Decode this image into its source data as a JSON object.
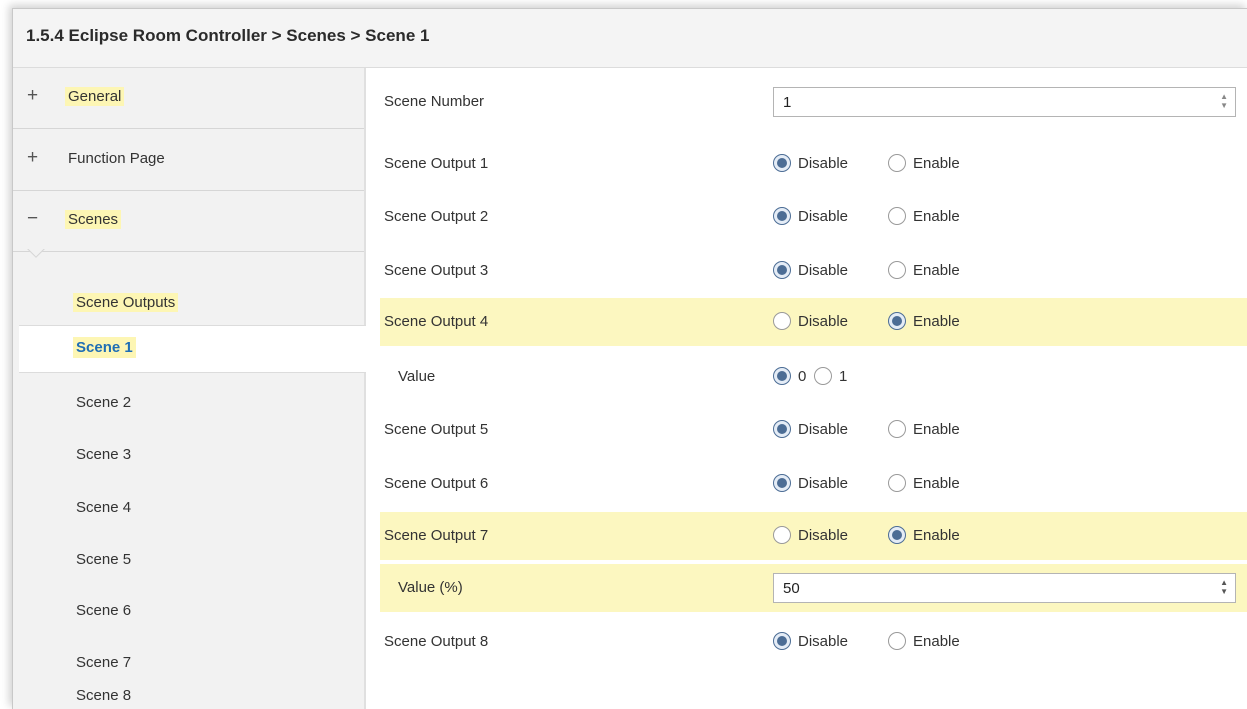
{
  "header": {
    "breadcrumb": "1.5.4 Eclipse Room Controller > Scenes > Scene 1"
  },
  "sidebar": {
    "sections": [
      {
        "sign": "+",
        "label": "General"
      },
      {
        "sign": "+",
        "label": "Function Page"
      },
      {
        "sign": "−",
        "label": "Scenes"
      }
    ],
    "scene_items": [
      "Scene Outputs",
      "Scene 1",
      "Scene 2",
      "Scene 3",
      "Scene 4",
      "Scene 5",
      "Scene 6",
      "Scene 7",
      "Scene 8"
    ],
    "selected_item": "Scene 1"
  },
  "params": {
    "scene_number": {
      "label": "Scene Number",
      "value": "1"
    },
    "radio_options": {
      "disable": "Disable",
      "enable": "Enable",
      "zero": "0",
      "one": "1"
    },
    "outputs": [
      {
        "label": "Scene Output 1",
        "selected": "Disable"
      },
      {
        "label": "Scene Output 2",
        "selected": "Disable"
      },
      {
        "label": "Scene Output 3",
        "selected": "Disable"
      },
      {
        "label": "Scene Output 4",
        "selected": "Enable"
      },
      {
        "label": "Scene Output 5",
        "selected": "Disable"
      },
      {
        "label": "Scene Output 6",
        "selected": "Disable"
      },
      {
        "label": "Scene Output 7",
        "selected": "Enable"
      },
      {
        "label": "Scene Output 8",
        "selected": "Disable"
      }
    ],
    "output4_value": {
      "label": "Value",
      "selected": "0"
    },
    "output7_value": {
      "label": "Value (%)",
      "value": "50"
    }
  },
  "colors": {
    "highlight": "#fcf7c0",
    "active_text": "#1f6eb5",
    "radio_on": "#4c6d95"
  }
}
